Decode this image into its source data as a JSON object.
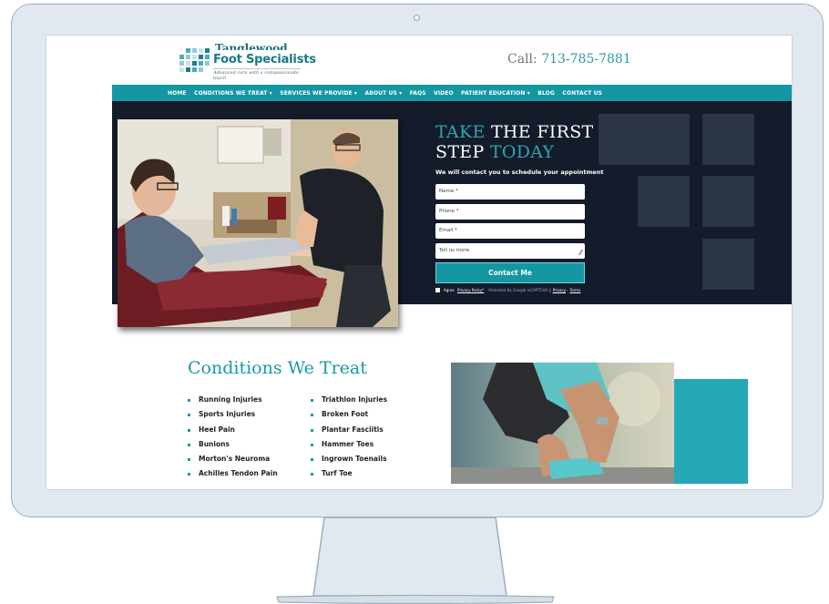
{
  "brand": {
    "name_top": "Tanglewood",
    "name": "Foot Specialists",
    "tagline": "Advanced care with a compassionate touch",
    "colors": {
      "teal": "#1497a2",
      "navy": "#141b2a"
    }
  },
  "header": {
    "call_label": "Call:",
    "phone": "713-785-7881"
  },
  "nav": {
    "items": [
      "HOME",
      "CONDITIONS WE TREAT ▾",
      "SERVICES WE PROVIDE ▾",
      "ABOUT US ▾",
      "FAQS",
      "VIDEO",
      "PATIENT EDUCATION ▾",
      "BLOG",
      "CONTACT US"
    ]
  },
  "hero": {
    "title_part1": "TAKE",
    "title_part2": " THE FIRST",
    "title_part3": "STEP",
    "title_part4": " TODAY",
    "subtitle": "We will contact you to schedule your appointment",
    "form": {
      "name_placeholder": "Name *",
      "phone_placeholder": "Phone *",
      "email_placeholder": "Email *",
      "message_placeholder": "Tell us more.",
      "submit_label": "Contact Me",
      "agree_label": "Agree",
      "privacy_label": "Privacy Policy*",
      "recaptcha_text": "Protected By Google reCAPTCHA",
      "privacy_link": "Privacy",
      "terms_link": "Terms"
    }
  },
  "conditions": {
    "title": "Conditions We Treat",
    "col1": [
      "Running Injuries",
      "Sports Injuries",
      "Heel Pain",
      "Bunions",
      "Morton's Neuroma",
      "Achilles Tendon Pain"
    ],
    "col2": [
      "Triathlon Injuries",
      "Broken Foot",
      "Plantar Fasciitis",
      "Hammer Toes",
      "Ingrown Toenails",
      "Turf Toe"
    ]
  },
  "icons": {
    "logo": "grid-logo-icon",
    "resize": "resize-handle-icon",
    "camera": "webcam-icon"
  }
}
